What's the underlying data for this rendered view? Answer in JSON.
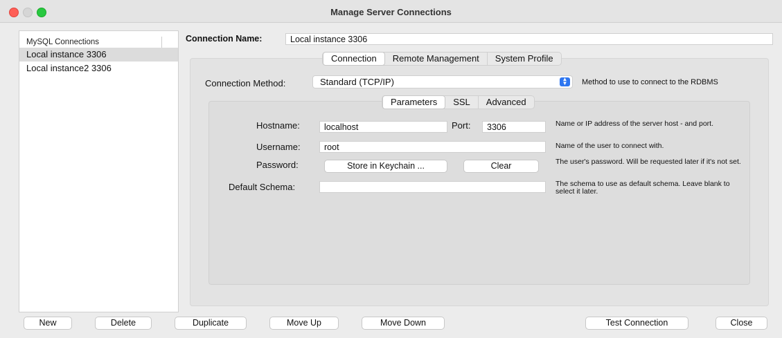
{
  "window": {
    "title": "Manage Server Connections"
  },
  "sidebar": {
    "header": "MySQL Connections",
    "items": [
      {
        "label": "Local instance 3306",
        "selected": true
      },
      {
        "label": "Local instance2 3306",
        "selected": false
      }
    ]
  },
  "connection_name": {
    "label": "Connection Name:",
    "value": "Local instance 3306"
  },
  "main_tabs": [
    {
      "label": "Connection",
      "active": true
    },
    {
      "label": "Remote Management",
      "active": false
    },
    {
      "label": "System Profile",
      "active": false
    }
  ],
  "connection_method": {
    "label": "Connection Method:",
    "value": "Standard (TCP/IP)",
    "description": "Method to use to connect to the RDBMS"
  },
  "sub_tabs": [
    {
      "label": "Parameters",
      "active": true
    },
    {
      "label": "SSL",
      "active": false
    },
    {
      "label": "Advanced",
      "active": false
    }
  ],
  "params": {
    "hostname": {
      "label": "Hostname:",
      "value": "localhost",
      "description": "Name or IP address of the server host - and port."
    },
    "port": {
      "label": "Port:",
      "value": "3306"
    },
    "username": {
      "label": "Username:",
      "value": "root",
      "description": "Name of the user to connect with."
    },
    "password": {
      "label": "Password:",
      "store_button": "Store in Keychain ...",
      "clear_button": "Clear",
      "description": "The user's password. Will be requested later if it's not set."
    },
    "default_schema": {
      "label": "Default Schema:",
      "value": "",
      "description": "The schema to use as default schema. Leave blank to select it later."
    }
  },
  "footer": {
    "new": "New",
    "delete": "Delete",
    "duplicate": "Duplicate",
    "move_up": "Move Up",
    "move_down": "Move Down",
    "test_connection": "Test Connection",
    "close": "Close"
  },
  "colors": {
    "accent": "#2e76f0",
    "traffic_close": "#fe5f57",
    "traffic_max": "#28c840"
  }
}
